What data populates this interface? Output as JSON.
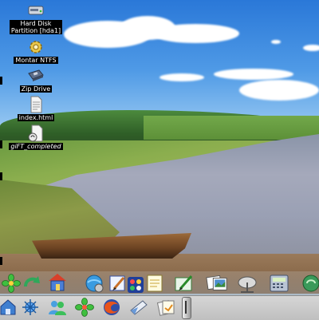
{
  "desktop": {
    "icons": [
      {
        "label": "Hard Disk\nPartition [hda1]",
        "icon": "hard-disk-icon"
      },
      {
        "label": "Montar NTFS",
        "icon": "gear-icon"
      },
      {
        "label": "Zip Drive",
        "icon": "zip-drive-icon"
      },
      {
        "label": "index.html",
        "icon": "html-file-icon"
      },
      {
        "label": "giFT_completed",
        "icon": "folder-document-icon"
      }
    ]
  },
  "panel": {
    "top_row": [
      "icq-flower-icon",
      "refresh-arrow-icon",
      "home-folder-icon",
      "globe-settings-icon",
      "paint-brush-icon",
      "color-palette-icon",
      "notepad-icon",
      "editor-pen-icon",
      "photos-icon",
      "satellite-dish-icon",
      "calculator-icon",
      "terminal-icon"
    ],
    "bottom_row": [
      "home-icon",
      "network-icon",
      "users-icon",
      "icq-flower-icon",
      "firefox-icon",
      "mail-icon",
      "documents-icon",
      "panel-handle"
    ]
  },
  "colors": {
    "label_bg": "#000000",
    "label_fg": "#ffffff",
    "sky": "#2a78d8",
    "panel": "#c8c8c8"
  }
}
